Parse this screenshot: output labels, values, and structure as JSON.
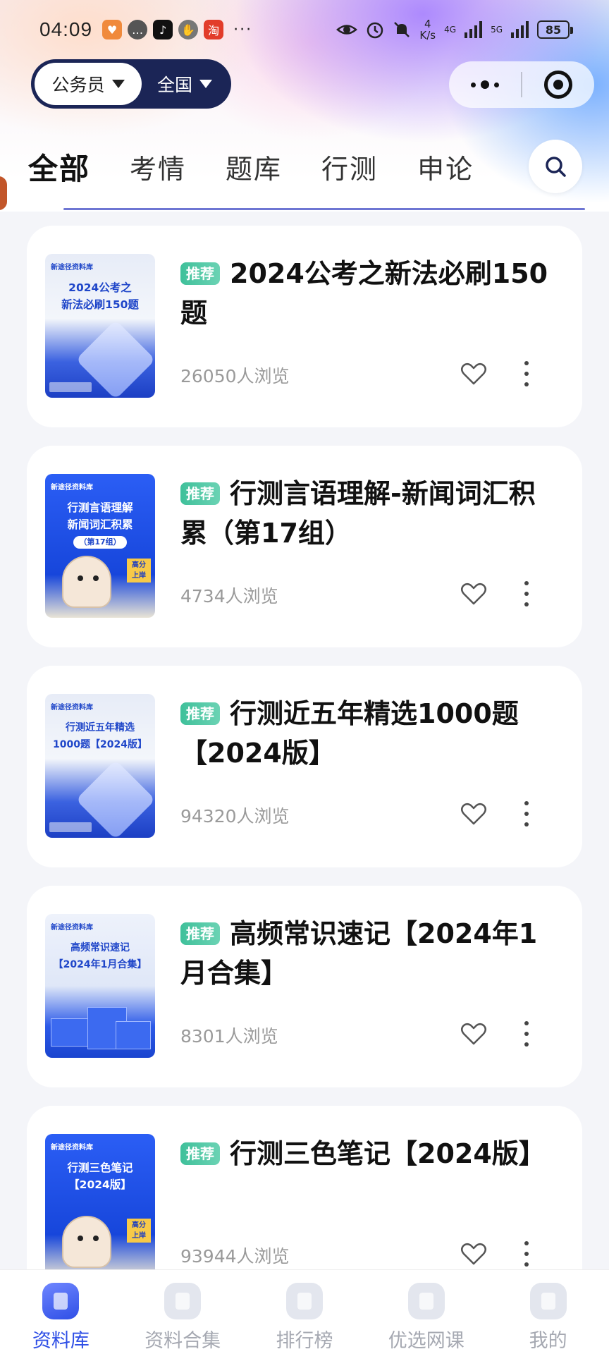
{
  "status_bar": {
    "time": "04:09",
    "net_speed_top": "4",
    "net_speed_unit": "K/s",
    "net_type_a": "4G",
    "net_type_b": "5G",
    "battery": "85",
    "more": "···"
  },
  "selector": {
    "exam": "公务员",
    "region": "全国"
  },
  "tabs": [
    {
      "label": "全部",
      "active": true
    },
    {
      "label": "考情",
      "active": false
    },
    {
      "label": "题库",
      "active": false
    },
    {
      "label": "行测",
      "active": false
    },
    {
      "label": "申论",
      "active": false
    }
  ],
  "cards": [
    {
      "tag": "推荐",
      "title": "2024公考之新法必刷150题",
      "views": "26050人浏览",
      "cover": {
        "brand": "新途径资料库",
        "title": "2024公考之\n新法必刷150题"
      }
    },
    {
      "tag": "推荐",
      "title": "行测言语理解-新闻词汇积累（第17组）",
      "views": "4734人浏览",
      "cover": {
        "brand": "新途径资料库",
        "title": "行测言语理解\n新闻词汇积累",
        "sub": "（第17组）",
        "badge": "高分\n上岸"
      }
    },
    {
      "tag": "推荐",
      "title": "行测近五年精选1000题【2024版】",
      "views": "94320人浏览",
      "cover": {
        "brand": "新途径资料库",
        "title": "行测近五年精选\n1000题【2024版】"
      }
    },
    {
      "tag": "推荐",
      "title": "高频常识速记【2024年1月合集】",
      "views": "8301人浏览",
      "cover": {
        "brand": "新途径资料库",
        "title": "高频常识速记\n【2024年1月合集】"
      }
    },
    {
      "tag": "推荐",
      "title": "行测三色笔记【2024版】",
      "views": "93944人浏览",
      "cover": {
        "brand": "新途径资料库",
        "title": "行测三色笔记\n【2024版】",
        "badge": "高分\n上岸"
      }
    }
  ],
  "bottom_nav": [
    {
      "label": "资料库",
      "active": true
    },
    {
      "label": "资料合集",
      "active": false
    },
    {
      "label": "排行榜",
      "active": false
    },
    {
      "label": "优选网课",
      "active": false
    },
    {
      "label": "我的",
      "active": false
    }
  ],
  "colors": {
    "accent": "#2f4fe6",
    "tag": "#45c29a",
    "selector_bg": "#1b2556"
  },
  "icons": [
    "search-icon",
    "heart-icon",
    "more-vertical-icon",
    "more-dots-icon",
    "target-icon",
    "triangle-down-icon"
  ]
}
